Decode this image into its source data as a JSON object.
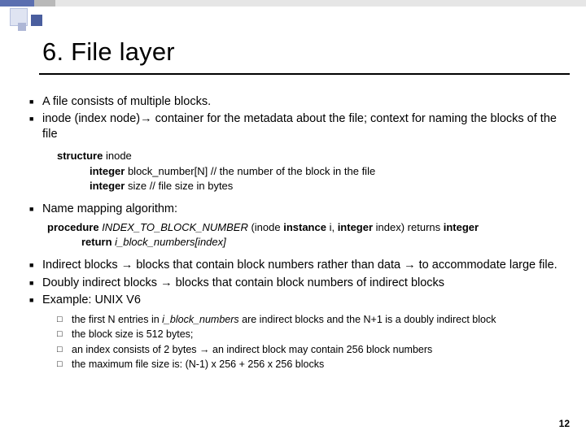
{
  "title": "6. File layer",
  "bullets": {
    "a": "A file consists of multiple blocks.",
    "b_pre": "inode (index node)",
    "b_arr": "→",
    "b_post": " container for the metadata about the file; context for naming the blocks of the file",
    "c": "Name mapping algorithm:",
    "d_pre": "Indirect blocks ",
    "d_arr1": "→",
    "d_mid": " blocks that contain block numbers rather than data ",
    "d_arr2": "→",
    "d_post": " to accommodate large file.",
    "e_pre": "Doubly indirect blocks ",
    "e_arr": "→",
    "e_post": " blocks that contain block numbers of indirect blocks",
    "f": "Example: UNIX V6"
  },
  "code1": {
    "l1_kw": "structure",
    "l1_rest": " inode",
    "l2a_kw": "integer",
    "l2a_mid": "  block_number[N]   ",
    "l2a_cmt": "// the number of the block in the file",
    "l2b_kw": "integer",
    "l2b_mid": " size       ",
    "l2b_cmt": "// file size in bytes"
  },
  "code2": {
    "l1_kw1": "procedure",
    "l1_name": " INDEX_TO_BLOCK_NUMBER ",
    "l1_p1": "(inode ",
    "l1_kw2": "instance",
    "l1_p2": " i, ",
    "l1_kw3": "integer",
    "l1_p3": " index) returns ",
    "l1_kw4": "integer",
    "l2_kw": "return",
    "l2_rest": " i_block_numbers[index]"
  },
  "sub": {
    "s1_a": "the first N entries in  ",
    "s1_it": "i_block_numbers",
    "s1_b": " are indirect blocks and the N+1 is a doubly indirect block",
    "s2": "the block size is 512 bytes;",
    "s3_a": "an index consists of 2 bytes ",
    "s3_arr": "→",
    "s3_b": " an indirect block may contain 256 block numbers",
    "s4": "the maximum file size is: (N-1) x 256 + 256 x 256 blocks"
  },
  "marks": {
    "square": "■",
    "hollow": "□"
  },
  "pagenum": "12"
}
